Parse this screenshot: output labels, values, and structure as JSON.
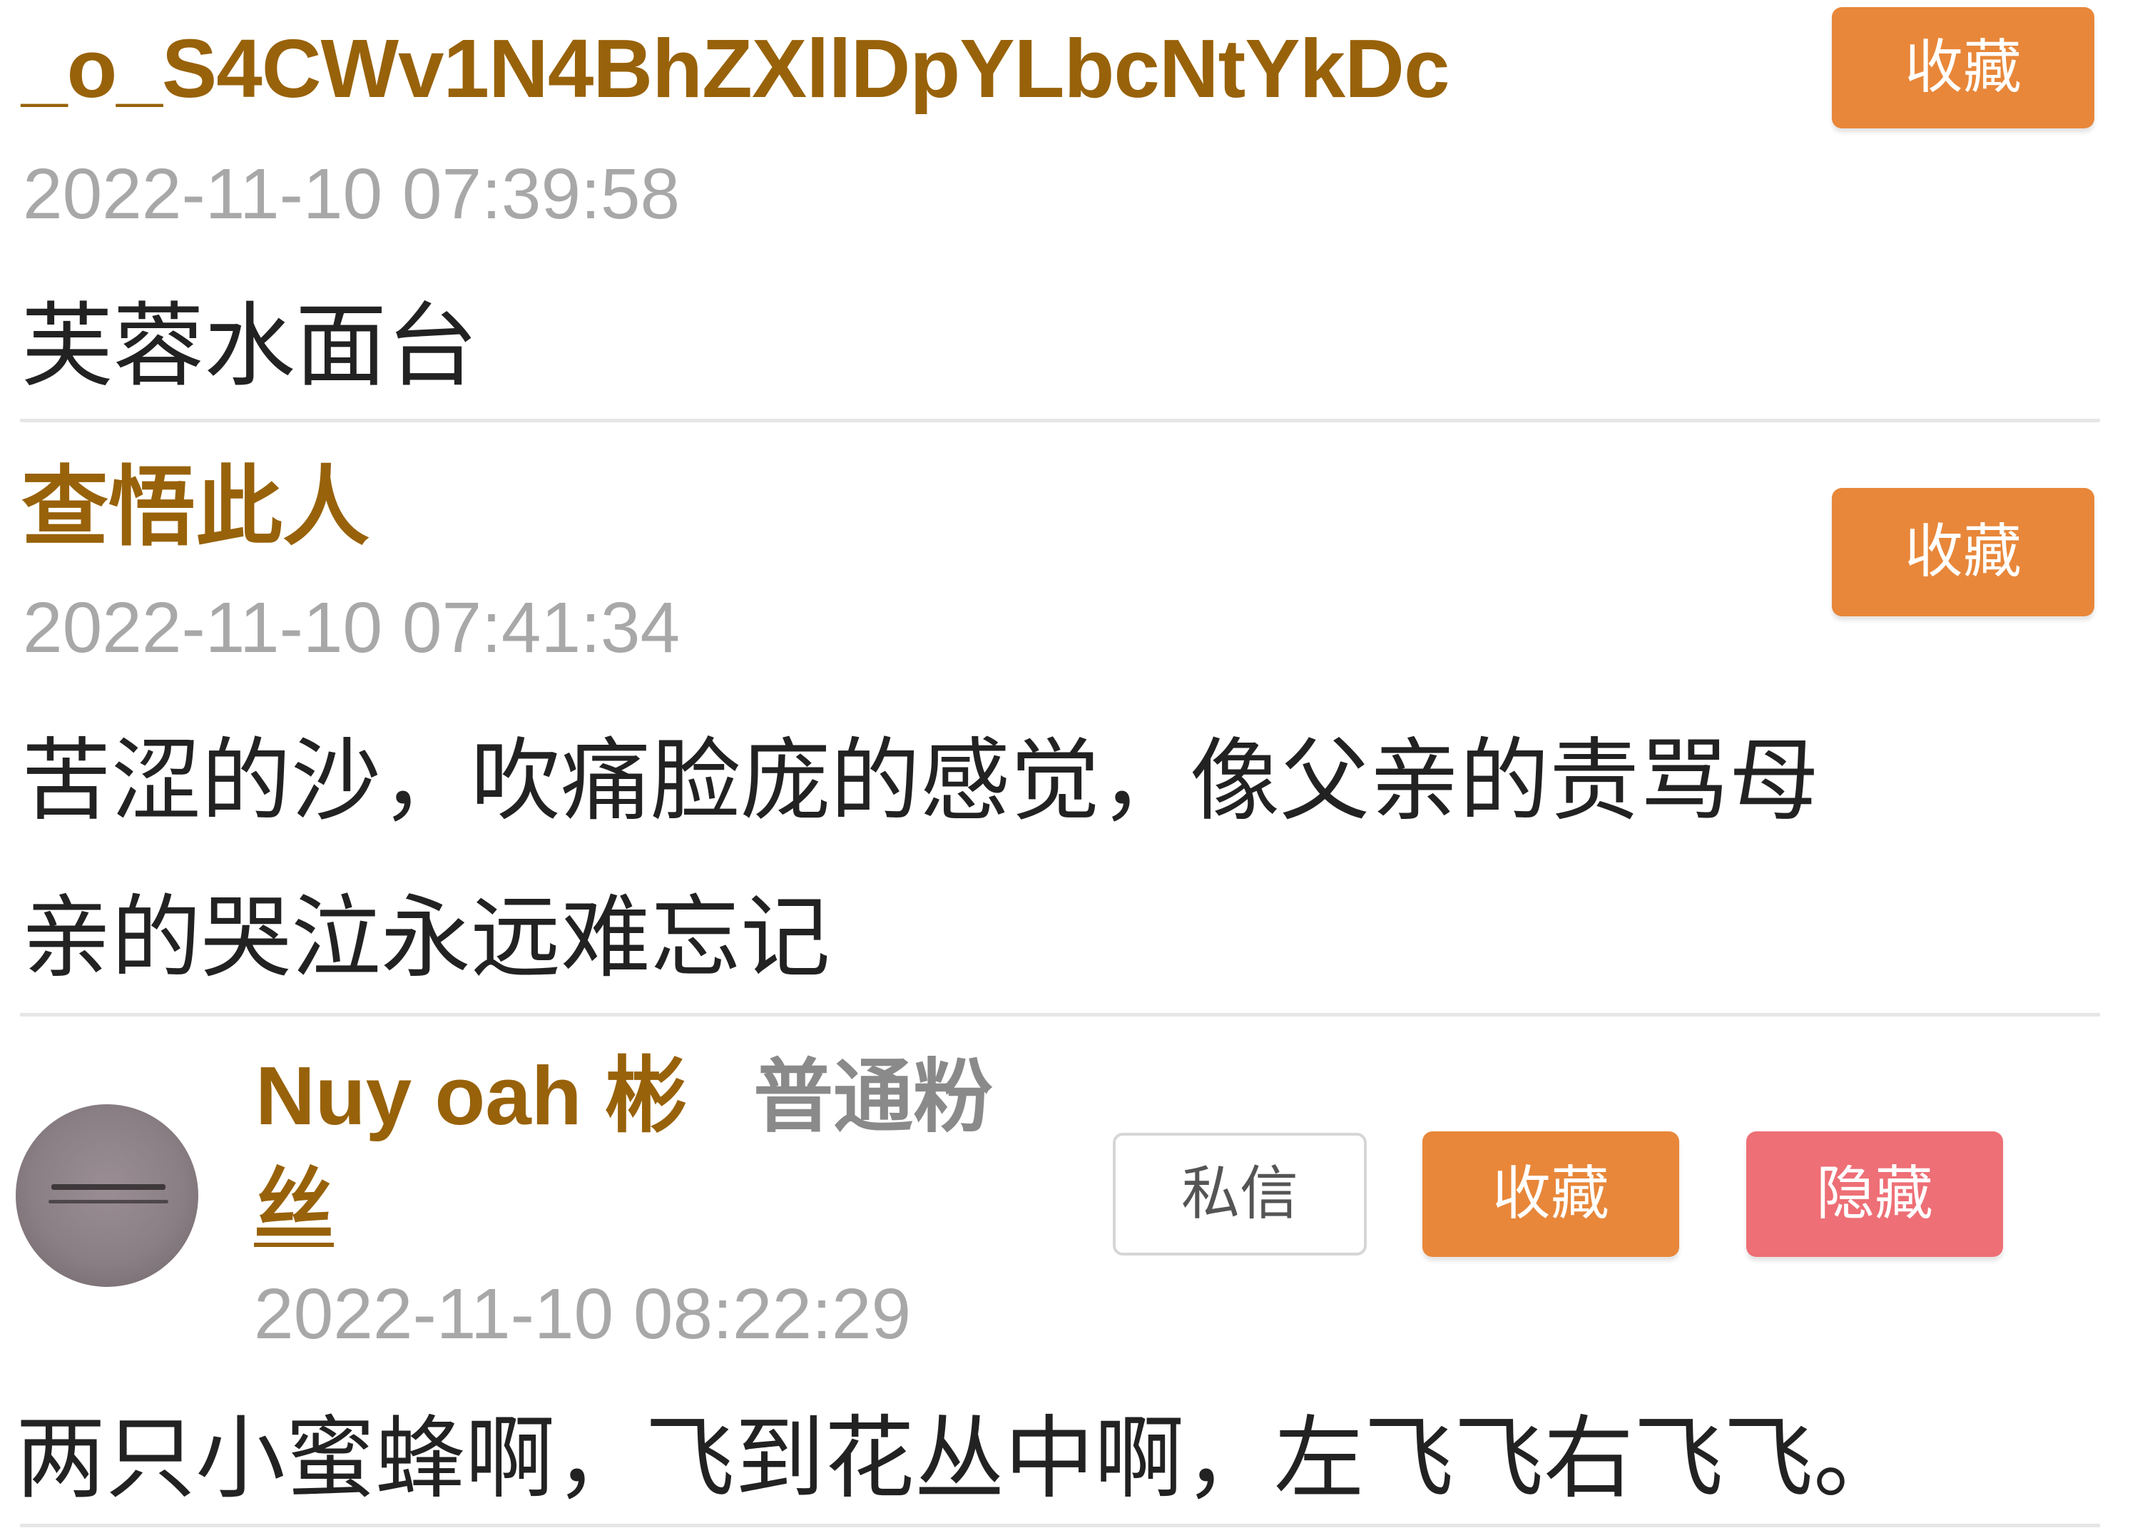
{
  "comments": [
    {
      "username": "_o_S4CWv1N4BhZXllDpYLbcNtYkDc",
      "timestamp": "2022-11-10 07:39:58",
      "content": "芙蓉水面台",
      "favorite_label": "收藏"
    },
    {
      "username": "查悟此人",
      "timestamp": "2022-11-10 07:41:34",
      "content_line1": "苦涩的沙，吹痛脸庞的感觉，像父亲的责骂母",
      "content_line2": "亲的哭泣永远难忘记",
      "favorite_label": "收藏"
    },
    {
      "username": "Nuy oah 彬",
      "fan_level_main": "普通粉",
      "fan_level_tail": "丝",
      "timestamp": "2022-11-10 08:22:29",
      "content": "两只小蜜蜂啊，飞到花丛中啊，左飞飞右飞飞。",
      "message_label": "私信",
      "favorite_label": "收藏",
      "hide_label": "隐藏"
    }
  ],
  "colors": {
    "username": "#98620a",
    "timestamp": "#a8a8a8",
    "favorite_button": "#e8873a",
    "hide_button": "#ee6f76",
    "divider": "#e6e6e6"
  }
}
